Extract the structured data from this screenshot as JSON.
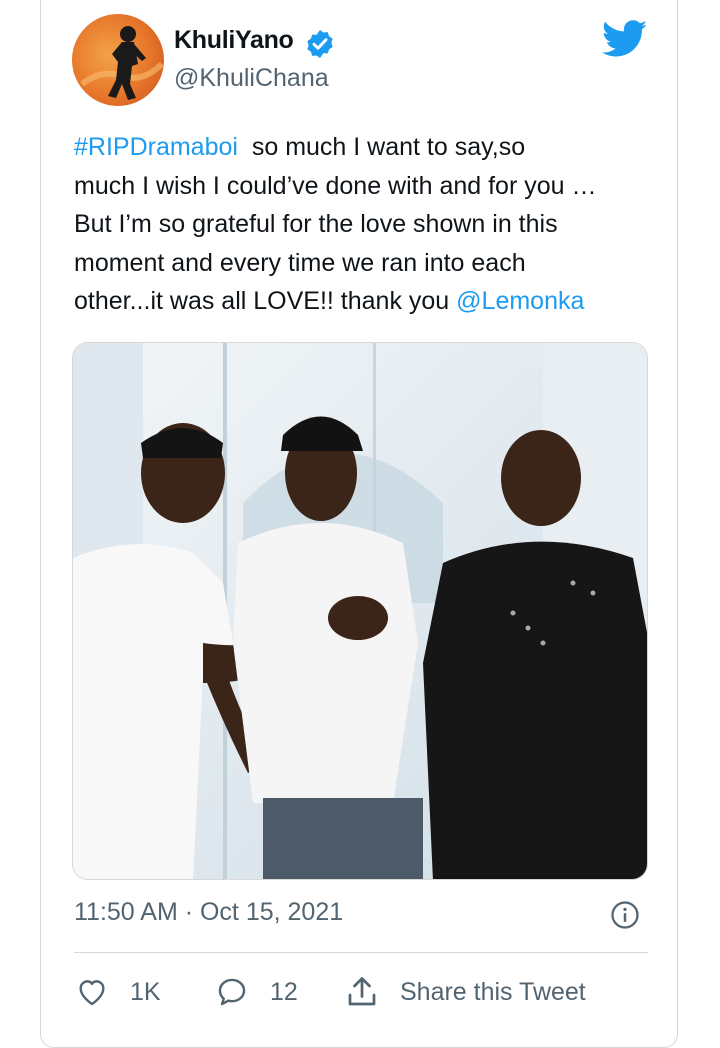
{
  "tweet": {
    "author_name": "KhuliYano",
    "author_handle": "@KhuliChana",
    "text_lines": [
      [
        {
          "t": "#RIPDramaboi",
          "link": true
        },
        {
          "t": "  so much I want to say,so",
          "link": false
        }
      ],
      [
        {
          "t": "much I wish I could’ve done with and for you …",
          "link": false
        }
      ],
      [
        {
          "t": "But I’m so grateful for the love shown in this",
          "link": false
        }
      ],
      [
        {
          "t": "moment and every time we ran into each",
          "link": false
        }
      ],
      [
        {
          "t": "other...it was all LOVE!! thank you ",
          "link": false
        },
        {
          "t": "@Lemonka",
          "link": true
        }
      ]
    ],
    "timestamp": "11:50 AM · Oct 15, 2021",
    "likes": "1K",
    "replies": "12",
    "share_label": "Share this Tweet"
  },
  "icons": {
    "verified": "verified-badge-icon",
    "brand": "twitter-bird-icon",
    "info": "info-icon",
    "like": "heart-icon",
    "reply": "reply-bubble-icon",
    "share": "share-upload-icon"
  },
  "colors": {
    "link": "#1d9bf0",
    "secondary_text": "#536471",
    "border": "#cfd9de"
  }
}
